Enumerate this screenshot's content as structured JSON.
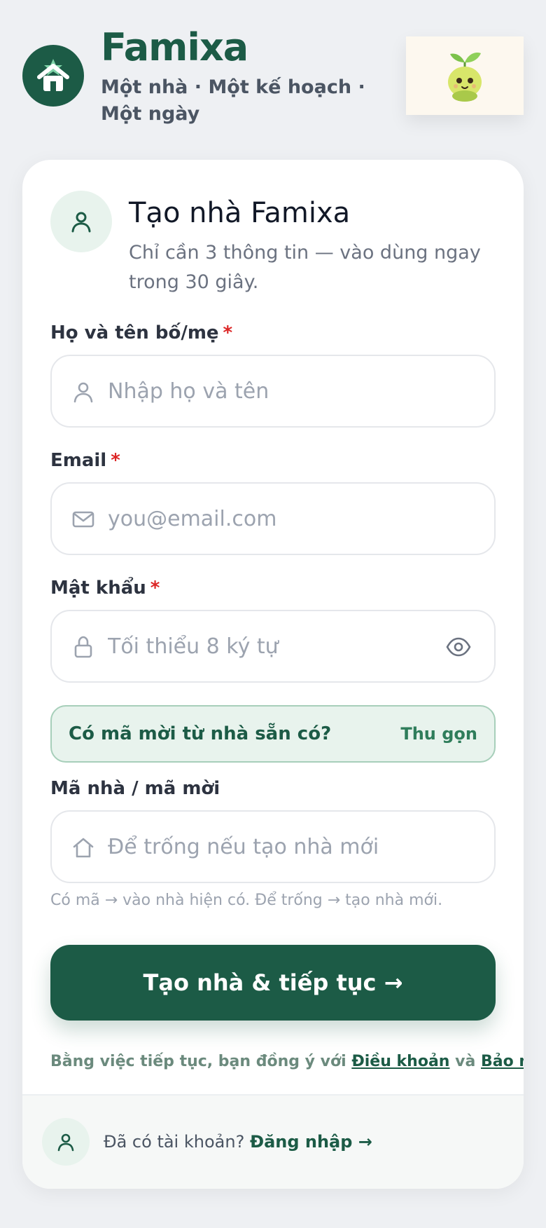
{
  "header": {
    "brand": "Famixa",
    "tagline": "Một nhà · Một kế hoạch · Một ngày",
    "logo_icon": "house-icon",
    "mascot": "sprout-mascot"
  },
  "card": {
    "title": "Tạo nhà Famixa",
    "subtitle": "Chỉ cần 3 thông tin — vào dùng ngay trong 30 giây.",
    "head_icon": "user-icon"
  },
  "form": {
    "name": {
      "label": "Họ và tên bố/mẹ",
      "required_mark": "*",
      "placeholder": "Nhập họ và tên",
      "value": "",
      "icon": "user-icon"
    },
    "email": {
      "label": "Email",
      "required_mark": "*",
      "placeholder": "you@email.com",
      "value": "",
      "icon": "mail-icon"
    },
    "password": {
      "label": "Mật khẩu",
      "required_mark": "*",
      "placeholder": "Tối thiểu 8 ký tự",
      "value": "",
      "icon": "lock-icon",
      "toggle_icon": "eye-icon"
    },
    "invite_toggle": {
      "question": "Có mã mời từ nhà sẵn có?",
      "action": "Thu gọn"
    },
    "house_code": {
      "label": "Mã nhà / mã mời",
      "placeholder": "Để trống nếu tạo nhà mới",
      "value": "",
      "icon": "home-outline-icon",
      "hint": "Có mã → vào nhà hiện có. Để trống → tạo nhà mới."
    },
    "submit_label": "Tạo nhà & tiếp tục →"
  },
  "terms": {
    "prefix": "Bằng việc tiếp tục, bạn đồng ý với",
    "terms_link": "Điều khoản",
    "and": "và",
    "privacy_link": "Bảo mật",
    "suffix": "."
  },
  "footer": {
    "prompt": "Đã có tài khoản?",
    "login_link": "Đăng nhập →",
    "icon": "user-icon"
  },
  "colors": {
    "brand": "#1c5b46",
    "accent_light": "#e8f3ed",
    "required": "#dc2626"
  }
}
